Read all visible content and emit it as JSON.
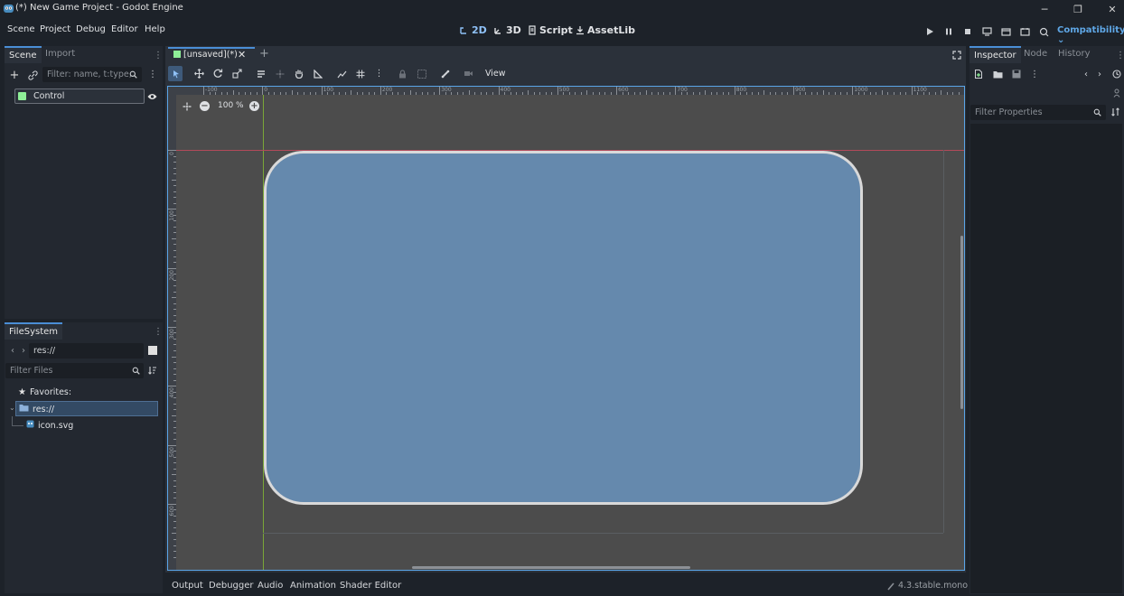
{
  "window": {
    "title": "(*) New Game Project - Godot Engine",
    "minimize": "─",
    "maximize": "❐",
    "close": "✕"
  },
  "menu": [
    "Scene",
    "Project",
    "Debug",
    "Editor",
    "Help"
  ],
  "workspaces": [
    {
      "label": "2D",
      "icon": "2d-icon"
    },
    {
      "label": "3D",
      "icon": "3d-icon"
    },
    {
      "label": "Script",
      "icon": "script-icon"
    },
    {
      "label": "AssetLib",
      "icon": "assetlib-icon"
    }
  ],
  "renderer": "Compatibility",
  "scene_dock": {
    "tabs": [
      "Scene",
      "Import"
    ],
    "filter_placeholder": "Filter: name, t:type,",
    "nodes": [
      {
        "name": "Control",
        "color": "#8eef97"
      }
    ]
  },
  "filesystem_dock": {
    "tab": "FileSystem",
    "path": "res://",
    "filter_placeholder": "Filter Files",
    "favorites_label": "Favorites:",
    "root_label": "res://",
    "files": [
      "icon.svg"
    ]
  },
  "editor": {
    "scene_tab": "[unsaved](*)",
    "view_menu": "View",
    "zoom": "100 %",
    "ruler_h": [
      "-100",
      "0",
      "100",
      "200",
      "300",
      "400",
      "500",
      "600",
      "700",
      "800",
      "900",
      "1000",
      "1100"
    ],
    "ruler_v": [
      "0",
      "100",
      "200",
      "300",
      "400",
      "500",
      "600"
    ]
  },
  "inspector_dock": {
    "tabs": [
      "Inspector",
      "Node",
      "History"
    ],
    "filter_placeholder": "Filter Properties"
  },
  "bottom_panel": {
    "tabs": [
      "Output",
      "Debugger",
      "Audio",
      "Animation",
      "Shader Editor"
    ],
    "version": "4.3.stable.mono"
  },
  "colors": {
    "accent": "#5fa7e6",
    "panel_fill": "#6589ad",
    "panel_border": "#d9d9d9",
    "node_icon": "#8eef97"
  }
}
